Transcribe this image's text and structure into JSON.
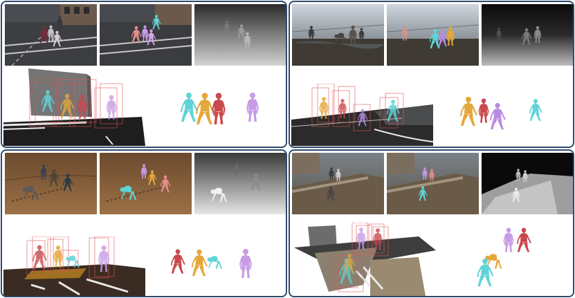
{
  "figure": {
    "panels": [
      {
        "id": "street",
        "views": [
          "rgb-frame",
          "mesh-overlay",
          "depth-map"
        ],
        "reconstruction": [
          "point-cloud-with-3d-boxes",
          "body-meshes"
        ],
        "mesh_colors": [
          "#5fd3d6",
          "#e4a73a",
          "#c9484c",
          "#c79be6"
        ]
      },
      {
        "id": "wasteland",
        "views": [
          "rgb-frame",
          "mesh-overlay",
          "depth-map"
        ],
        "reconstruction": [
          "point-cloud-with-3d-boxes",
          "body-meshes"
        ],
        "mesh_colors": [
          "#e4a73a",
          "#c9484c",
          "#b98be0",
          "#5fd3d6"
        ]
      },
      {
        "id": "beach",
        "views": [
          "rgb-frame",
          "mesh-overlay",
          "depth-map"
        ],
        "reconstruction": [
          "point-cloud-with-3d-boxes",
          "body-meshes"
        ],
        "mesh_colors": [
          "#c9484c",
          "#e4a73a",
          "#5fd3d6",
          "#c79be6"
        ]
      },
      {
        "id": "rooftop",
        "views": [
          "rgb-frame",
          "mesh-overlay",
          "depth-map"
        ],
        "reconstruction": [
          "point-cloud-with-3d-boxes",
          "body-meshes"
        ],
        "mesh_colors": [
          "#c79be6",
          "#c9484c",
          "#e4a73a",
          "#5fd3d6"
        ]
      }
    ],
    "frame_color": "#2f4a6e",
    "box_color": "#e05555"
  }
}
